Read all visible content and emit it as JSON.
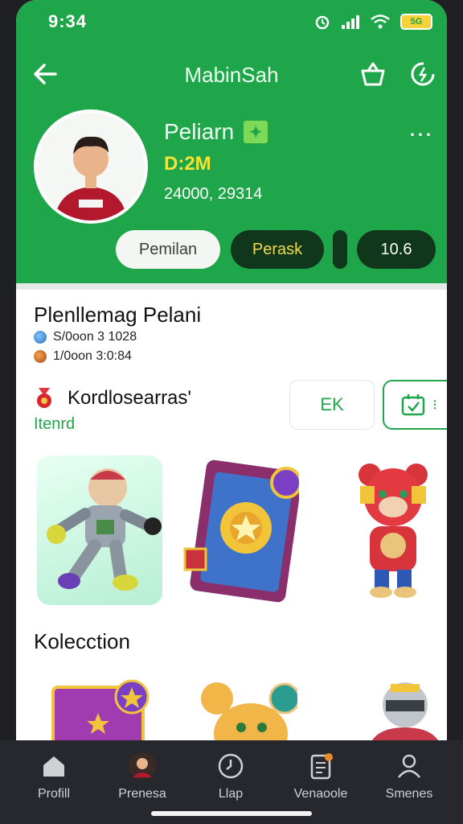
{
  "status_bar": {
    "time": "9:34",
    "battery": "5G"
  },
  "appbar": {
    "title": "MabinSah"
  },
  "profile": {
    "name": "Peliarn",
    "score": "D:2M",
    "meta": "24000, 29314",
    "pills": [
      "Pemilan",
      "Perask",
      "",
      "10.6"
    ]
  },
  "section1": {
    "title": "Plenllemag Pelani",
    "stats": [
      "S/0oon 3 1028",
      "1/0oon 3:0:84"
    ]
  },
  "collect": {
    "title": "Kordlosearras'",
    "sub": "Itenrd",
    "action_1": "EK"
  },
  "collection": {
    "title": "Kolecction"
  },
  "nav": {
    "items": [
      {
        "label": "Profill",
        "icon": "home-icon"
      },
      {
        "label": "Prenesa",
        "icon": "avatar-icon"
      },
      {
        "label": "Llap",
        "icon": "clock-icon"
      },
      {
        "label": "Venaoole",
        "icon": "document-icon"
      },
      {
        "label": "Smenes",
        "icon": "person-icon"
      }
    ]
  },
  "colors": {
    "brand_green": "#1fa64a",
    "dark_green": "#10371c",
    "accent_yellow": "#f2e437",
    "nav_bg": "#26282d"
  }
}
